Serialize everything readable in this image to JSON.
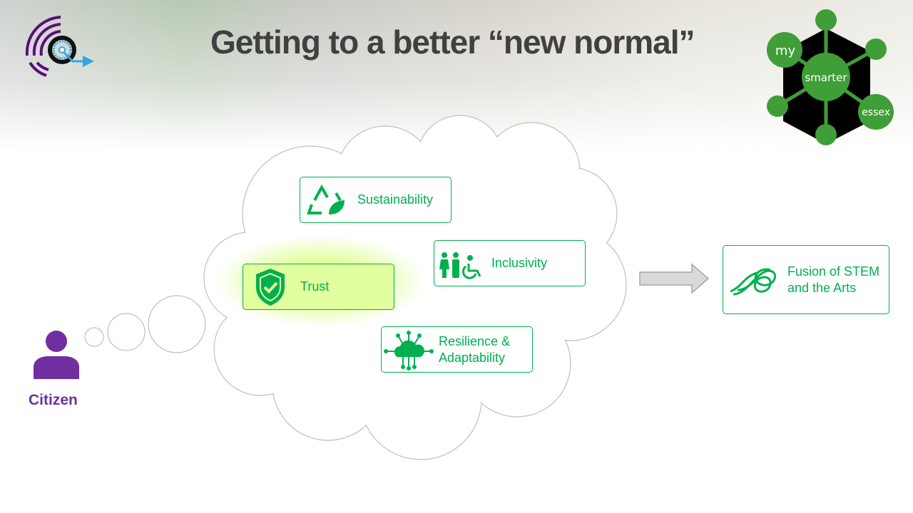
{
  "slide": {
    "title": "Getting to a better “new normal”"
  },
  "logo": {
    "words": [
      "my",
      "smarter",
      "essex"
    ]
  },
  "cloud_items": [
    {
      "label": "Sustainability",
      "icon": "recycle-leaf-icon"
    },
    {
      "label": "Inclusivity",
      "icon": "people-wheelchair-icon"
    },
    {
      "label": "Trust",
      "icon": "shield-check-icon"
    },
    {
      "label": "Resilience & Adaptability",
      "icon": "cloud-network-icon"
    }
  ],
  "outcome": {
    "label": "Fusion of STEM and the Arts",
    "icon": "knot-icon"
  },
  "citizen": {
    "label": "Citizen",
    "icon": "person-icon"
  },
  "colors": {
    "accent": "#00b050",
    "citizen": "#7030a0",
    "logo_green": "#3f9e37",
    "title": "#404040"
  }
}
